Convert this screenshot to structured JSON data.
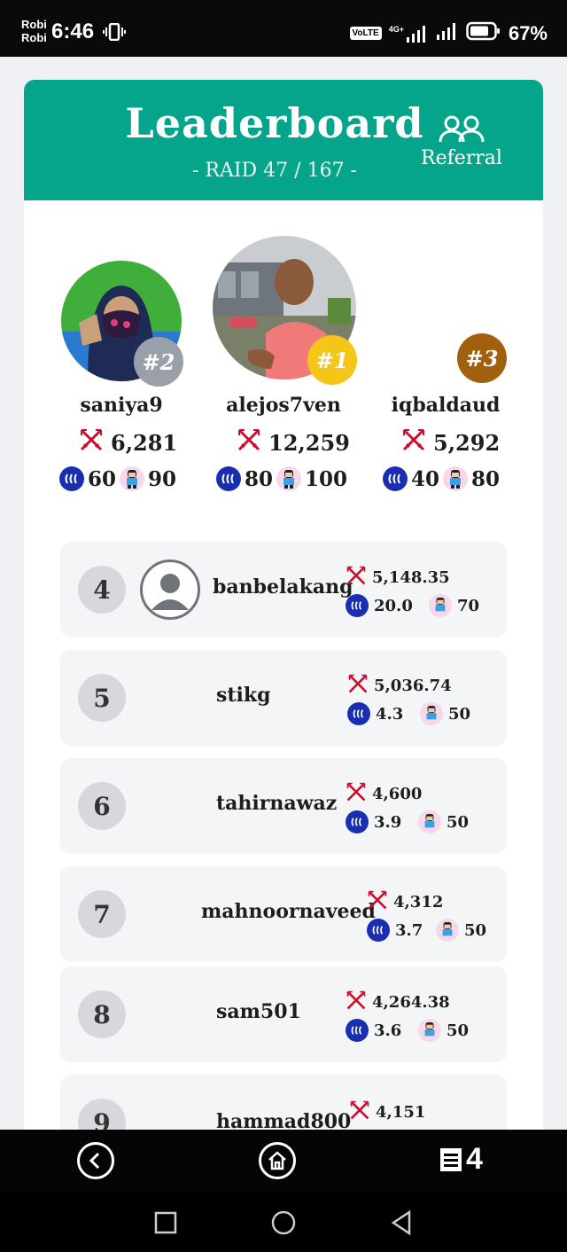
{
  "status_bar": {
    "carrier_1": "Robi",
    "carrier_2": "Robi",
    "time": "6:46",
    "volte": "VoLTE",
    "network": "4G+",
    "battery": "67%"
  },
  "header": {
    "title": "Leaderboard",
    "subtitle": "- RAID 47 / 167 -",
    "referral_label": "Referral",
    "color": "#05a58c"
  },
  "podium": [
    {
      "rank": "#2",
      "name": "saniya9",
      "score": "6,281",
      "steem": "60",
      "mascot": "90",
      "badge_color": "#9aa0aa"
    },
    {
      "rank": "#1",
      "name": "alejos7ven",
      "score": "12,259",
      "steem": "80",
      "mascot": "100",
      "badge_color": "#f5c518"
    },
    {
      "rank": "#3",
      "name": "iqbaldaud",
      "score": "5,292",
      "steem": "40",
      "mascot": "80",
      "badge_color": "#a0600e"
    }
  ],
  "rows": [
    {
      "rank": "4",
      "name": "banbelakang",
      "score": "5,148.35",
      "steem": "20.0",
      "mascot": "70"
    },
    {
      "rank": "5",
      "name": "stikg",
      "score": "5,036.74",
      "steem": "4.3",
      "mascot": "50"
    },
    {
      "rank": "6",
      "name": "tahirnawaz",
      "score": "4,600",
      "steem": "3.9",
      "mascot": "50"
    },
    {
      "rank": "7",
      "name": "mahnoornaveed",
      "score": "4,312",
      "steem": "3.7",
      "mascot": "50"
    },
    {
      "rank": "8",
      "name": "sam501",
      "score": "4,264.38",
      "steem": "3.6",
      "mascot": "50"
    },
    {
      "rank": "9",
      "name": "hammad800",
      "score": "4,151",
      "steem": "",
      "mascot": ""
    }
  ],
  "app_nav": {
    "count": "4"
  },
  "icons": {
    "score": "crossed-swords-icon",
    "steem": "steem-logo-icon",
    "mascot": "mascot-icon",
    "referral": "users-icon"
  }
}
